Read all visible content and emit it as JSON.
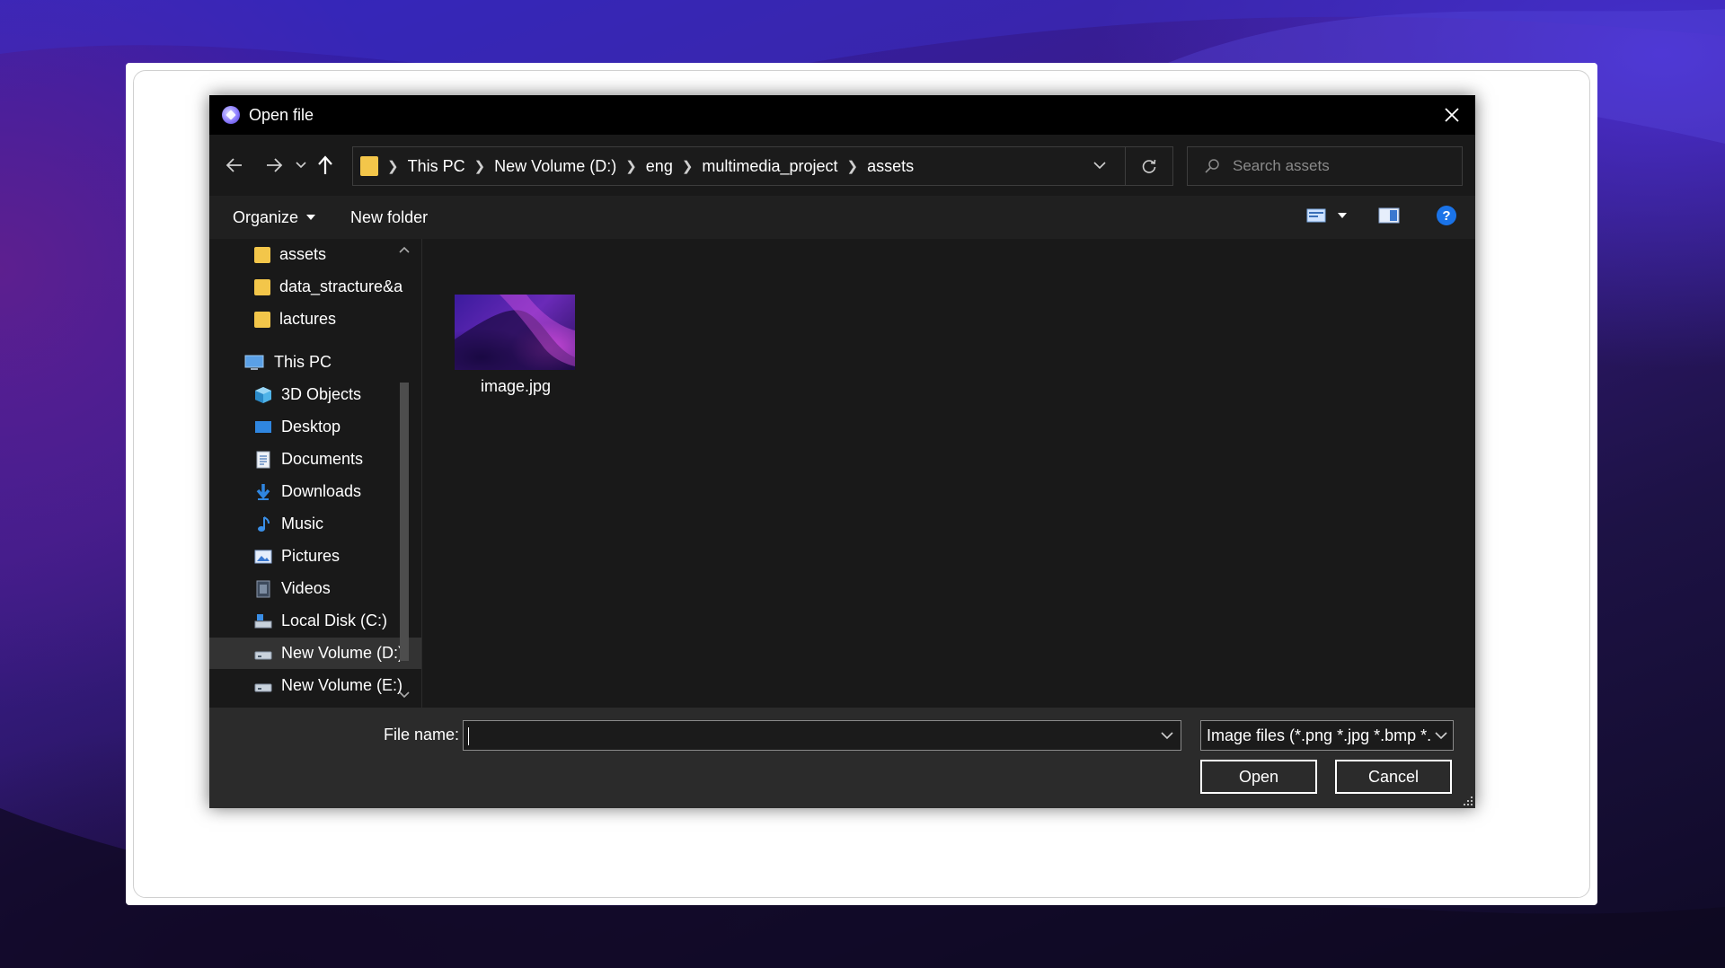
{
  "dialog": {
    "title": "Open file",
    "icons": {
      "app": "app-logo-icon",
      "close": "close-icon"
    }
  },
  "nav": {
    "back_icon": "back-arrow-icon",
    "forward_icon": "forward-arrow-icon",
    "recent_icon": "chevron-down-icon",
    "up_icon": "up-arrow-icon",
    "breadcrumbs": [
      "This PC",
      "New Volume (D:)",
      "eng",
      "multimedia_project",
      "assets"
    ],
    "refresh_icon": "refresh-icon",
    "search_placeholder": "Search assets"
  },
  "toolbar": {
    "organize": "Organize",
    "new_folder": "New folder"
  },
  "sidebar": {
    "items": [
      {
        "label": "assets",
        "icon": "folder-icon",
        "indent": 1
      },
      {
        "label": "data_stracture&a",
        "icon": "folder-icon",
        "indent": 1
      },
      {
        "label": "lactures",
        "icon": "folder-icon",
        "indent": 1
      },
      {
        "label": "This PC",
        "icon": "computer-icon",
        "indent": 0
      },
      {
        "label": "3D Objects",
        "icon": "3d-objects-icon",
        "indent": 1
      },
      {
        "label": "Desktop",
        "icon": "desktop-icon",
        "indent": 1
      },
      {
        "label": "Documents",
        "icon": "documents-icon",
        "indent": 1
      },
      {
        "label": "Downloads",
        "icon": "downloads-icon",
        "indent": 1
      },
      {
        "label": "Music",
        "icon": "music-icon",
        "indent": 1
      },
      {
        "label": "Pictures",
        "icon": "pictures-icon",
        "indent": 1
      },
      {
        "label": "Videos",
        "icon": "videos-icon",
        "indent": 1
      },
      {
        "label": "Local Disk (C:)",
        "icon": "local-disk-icon",
        "indent": 1
      },
      {
        "label": "New Volume (D:)",
        "icon": "drive-icon",
        "indent": 1,
        "selected": true
      },
      {
        "label": "New Volume (E:)",
        "icon": "drive-icon",
        "indent": 1
      }
    ]
  },
  "files": [
    {
      "name": "image.jpg",
      "type": "image-thumbnail"
    }
  ],
  "footer": {
    "file_name_label": "File name:",
    "file_name_value": "",
    "filter": "Image files (*.png *.jpg *.bmp *.",
    "open": "Open",
    "cancel": "Cancel"
  },
  "colors": {
    "dialog_bg": "#191919",
    "titlebar_bg": "#000000",
    "footer_bg": "#2b2b2b",
    "folder_yellow": "#f3c64a",
    "help_blue": "#1a73e8"
  }
}
